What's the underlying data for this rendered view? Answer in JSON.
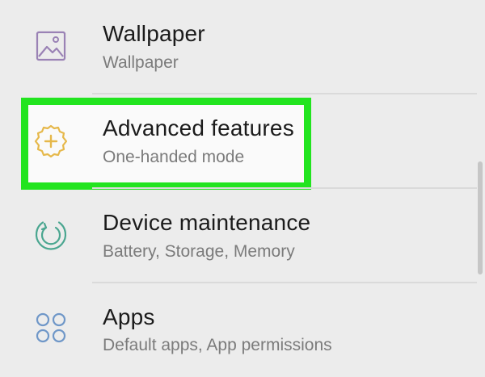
{
  "settings_list": {
    "items": [
      {
        "title": "Wallpaper",
        "subtitle": "Wallpaper",
        "icon": "wallpaper-icon",
        "icon_color": "#9a82b5"
      },
      {
        "title": "Advanced features",
        "subtitle": "One-handed mode",
        "icon": "gear-plus-icon",
        "icon_color": "#e6b84a",
        "highlighted": true
      },
      {
        "title": "Device maintenance",
        "subtitle": "Battery, Storage, Memory",
        "icon": "device-maintenance-icon",
        "icon_color": "#4aa690"
      },
      {
        "title": "Apps",
        "subtitle": "Default apps, App permissions",
        "icon": "apps-icon",
        "icon_color": "#6f97c8"
      }
    ]
  },
  "colors": {
    "highlight_border": "#22e41f",
    "background": "#ececec",
    "title_text": "#1b1b1b",
    "subtitle_text": "#7b7b7b"
  }
}
